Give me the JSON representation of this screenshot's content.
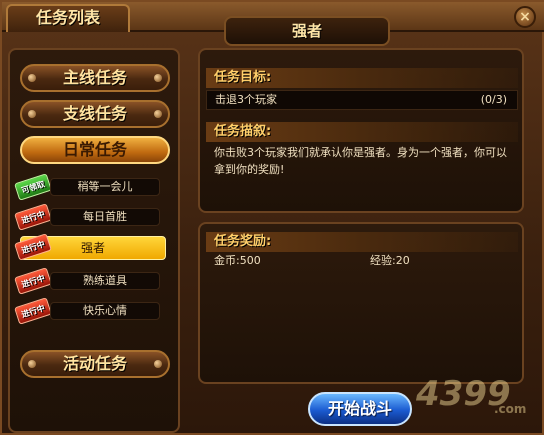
{
  "window": {
    "tab_title": "任务列表",
    "panel_title": "强者",
    "close_label": "×"
  },
  "categories": [
    {
      "label": "主线任务",
      "active": false
    },
    {
      "label": "支线任务",
      "active": false
    },
    {
      "label": "日常任务",
      "active": true
    },
    {
      "label": "活动任务",
      "active": false
    }
  ],
  "daily_tasks": [
    {
      "name": "稍等一会儿",
      "badge": "可领取",
      "badge_color": "green",
      "selected": false
    },
    {
      "name": "每日首胜",
      "badge": "进行中",
      "badge_color": "red",
      "selected": false
    },
    {
      "name": "强者",
      "badge": "进行中",
      "badge_color": "red",
      "selected": true
    },
    {
      "name": "熟练道具",
      "badge": "进行中",
      "badge_color": "red",
      "selected": false
    },
    {
      "name": "快乐心情",
      "badge": "进行中",
      "badge_color": "red",
      "selected": false
    }
  ],
  "detail": {
    "goal_heading": "任务目标:",
    "goal_text": "击退3个玩家",
    "goal_progress": "(0/3)",
    "desc_heading": "任务描叙:",
    "desc_text": "你击败3个玩家我们就承认你是强者。身为一个强者，你可以拿到你的奖励!",
    "reward_heading": "任务奖励:",
    "reward_gold": "金币:500",
    "reward_exp": "经验:20"
  },
  "start_button": "开始战斗",
  "watermark": {
    "digits": "4399",
    "suffix": ".com"
  },
  "colors": {
    "accent_gold": "#ffcf6a",
    "selected_yellow": "#ffd63a",
    "start_blue": "#1a5ad0"
  }
}
